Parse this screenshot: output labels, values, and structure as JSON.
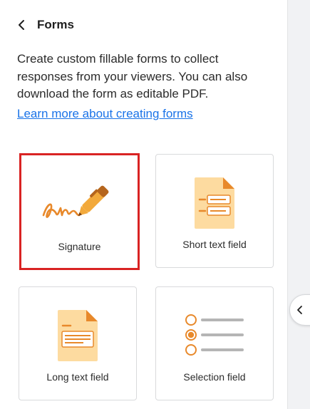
{
  "header": {
    "title": "Forms"
  },
  "description": "Create custom fillable forms to collect responses from your viewers. You can also download the form as editable PDF.",
  "learn_more": "Learn more about creating forms",
  "cards": [
    {
      "label": "Signature",
      "icon": "signature-icon",
      "selected": true
    },
    {
      "label": "Short text field",
      "icon": "short-text-field-icon",
      "selected": false
    },
    {
      "label": "Long text field",
      "icon": "long-text-field-icon",
      "selected": false
    },
    {
      "label": "Selection field",
      "icon": "selection-field-icon",
      "selected": false
    }
  ],
  "colors": {
    "accent_orange": "#e8892b",
    "doc_fill": "#fddba0",
    "selection_outline": "#d92323",
    "link": "#1a73e8"
  }
}
